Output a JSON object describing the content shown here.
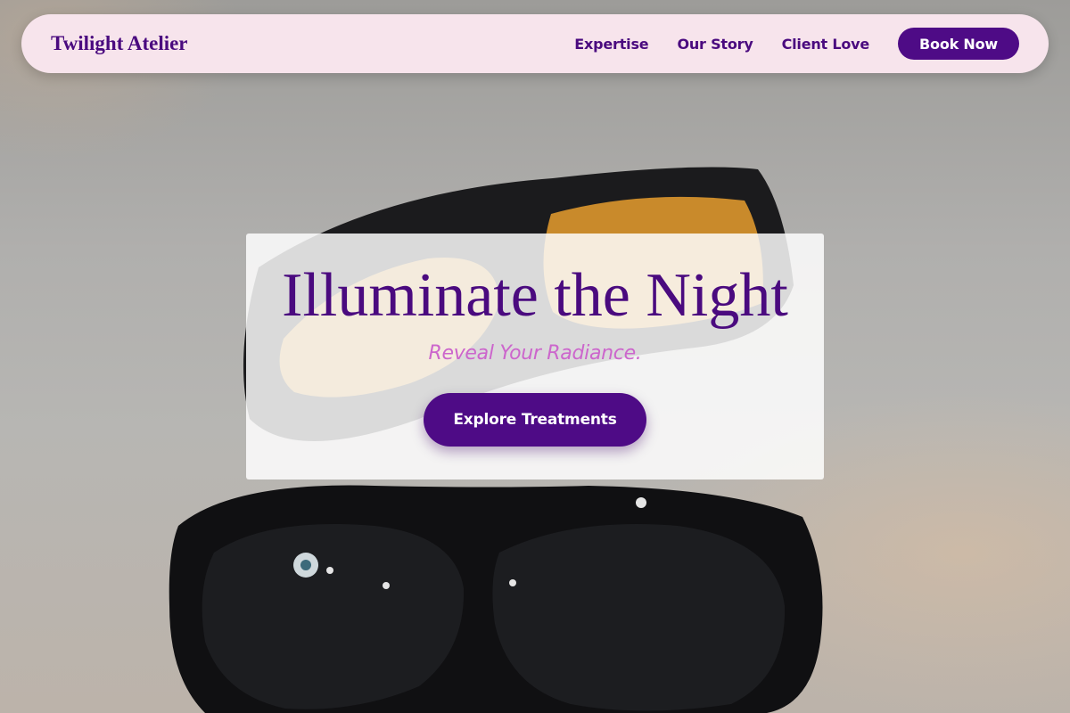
{
  "navbar": {
    "brand": "Twilight Atelier",
    "links": [
      "Expertise",
      "Our Story",
      "Client Love"
    ],
    "cta_label": "Book Now"
  },
  "hero": {
    "title": "Illuminate the Night",
    "subtitle": "Reveal Your Radiance.",
    "cta_label": "Explore Treatments",
    "background_image": "safety-goggles-photo"
  },
  "colors": {
    "brand_purple": "#4e0b86",
    "navbar_bg": "#f7e4ec",
    "subtitle_pink": "#cc66cc"
  }
}
